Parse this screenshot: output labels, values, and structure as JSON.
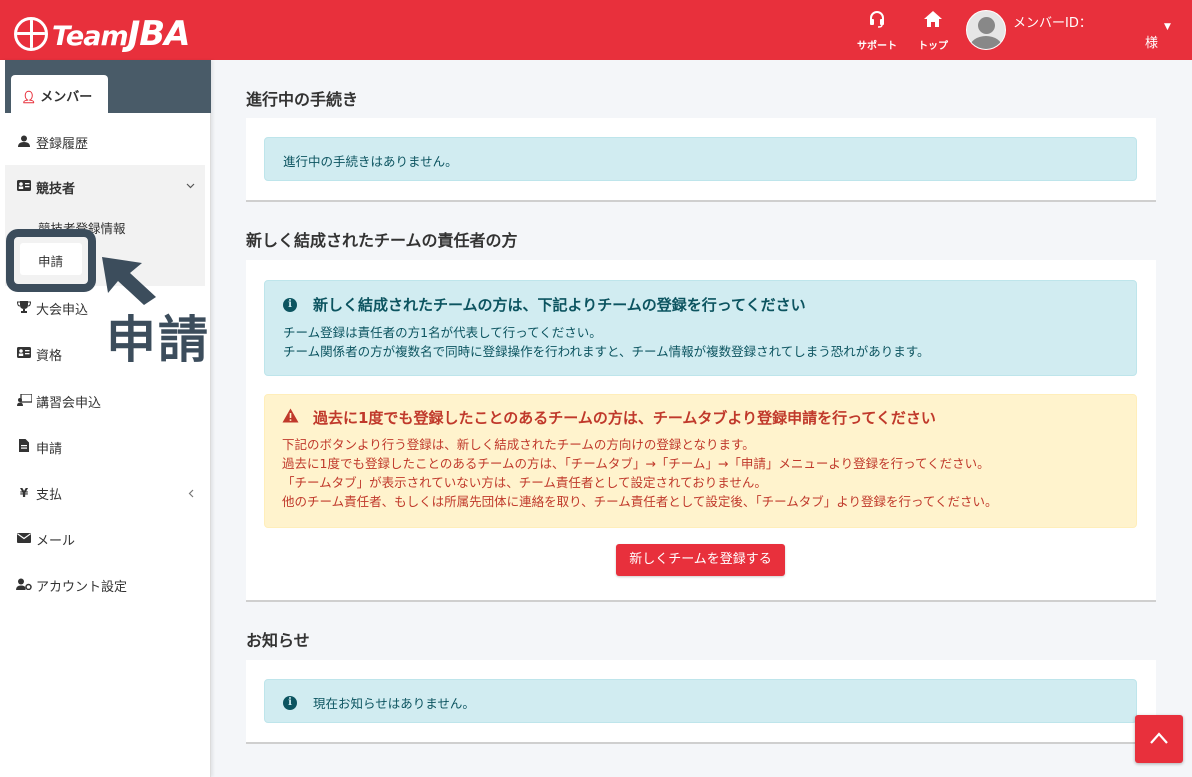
{
  "header": {
    "logo_team": "Team",
    "logo_jba": "JBA",
    "support_label": "サポート",
    "top_label": "トップ",
    "member_id_label": "メンバーID：",
    "sama": "様",
    "colors": {
      "primary": "#e8303c"
    }
  },
  "sidebar": {
    "member_tab": "メンバー",
    "items": {
      "history": "登録履歴",
      "athlete": "競技者",
      "athlete_info": "競技者登録情報",
      "athlete_apply": "申請",
      "tournament": "大会申込",
      "qualification": "資格",
      "seminar": "講習会申込",
      "apply": "申請",
      "payment": "支払",
      "mail": "メール",
      "account": "アカウント設定"
    }
  },
  "callout": {
    "text": "申請"
  },
  "sections": {
    "in_progress": {
      "title": "進行中の手続き",
      "message": "進行中の手続きはありません。"
    },
    "new_team": {
      "title": "新しく結成されたチームの責任者の方",
      "info_title": "新しく結成されたチームの方は、下記よりチームの登録を行ってください",
      "info_lines": [
        "チーム登録は責任者の方1名が代表して行ってください。",
        "チーム関係者の方が複数名で同時に登録操作を行われますと、チーム情報が複数登録されてしまう恐れがあります。"
      ],
      "warn_title": "過去に1度でも登録したことのあるチームの方は、チームタブより登録申請を行ってください",
      "warn_lines": [
        "下記のボタンより行う登録は、新しく結成されたチームの方向けの登録となります。",
        "過去に1度でも登録したことのあるチームの方は、「チームタブ」→「チーム」→「申請」メニューより登録を行ってください。",
        "「チームタブ」が表示されていない方は、チーム責任者として設定されておりません。",
        "他のチーム責任者、もしくは所属先団体に連絡を取り、チーム責任者として設定後、「チームタブ」より登録を行ってください。"
      ],
      "button": "新しくチームを登録する"
    },
    "news": {
      "title": "お知らせ",
      "message": "現在お知らせはありません。"
    }
  }
}
